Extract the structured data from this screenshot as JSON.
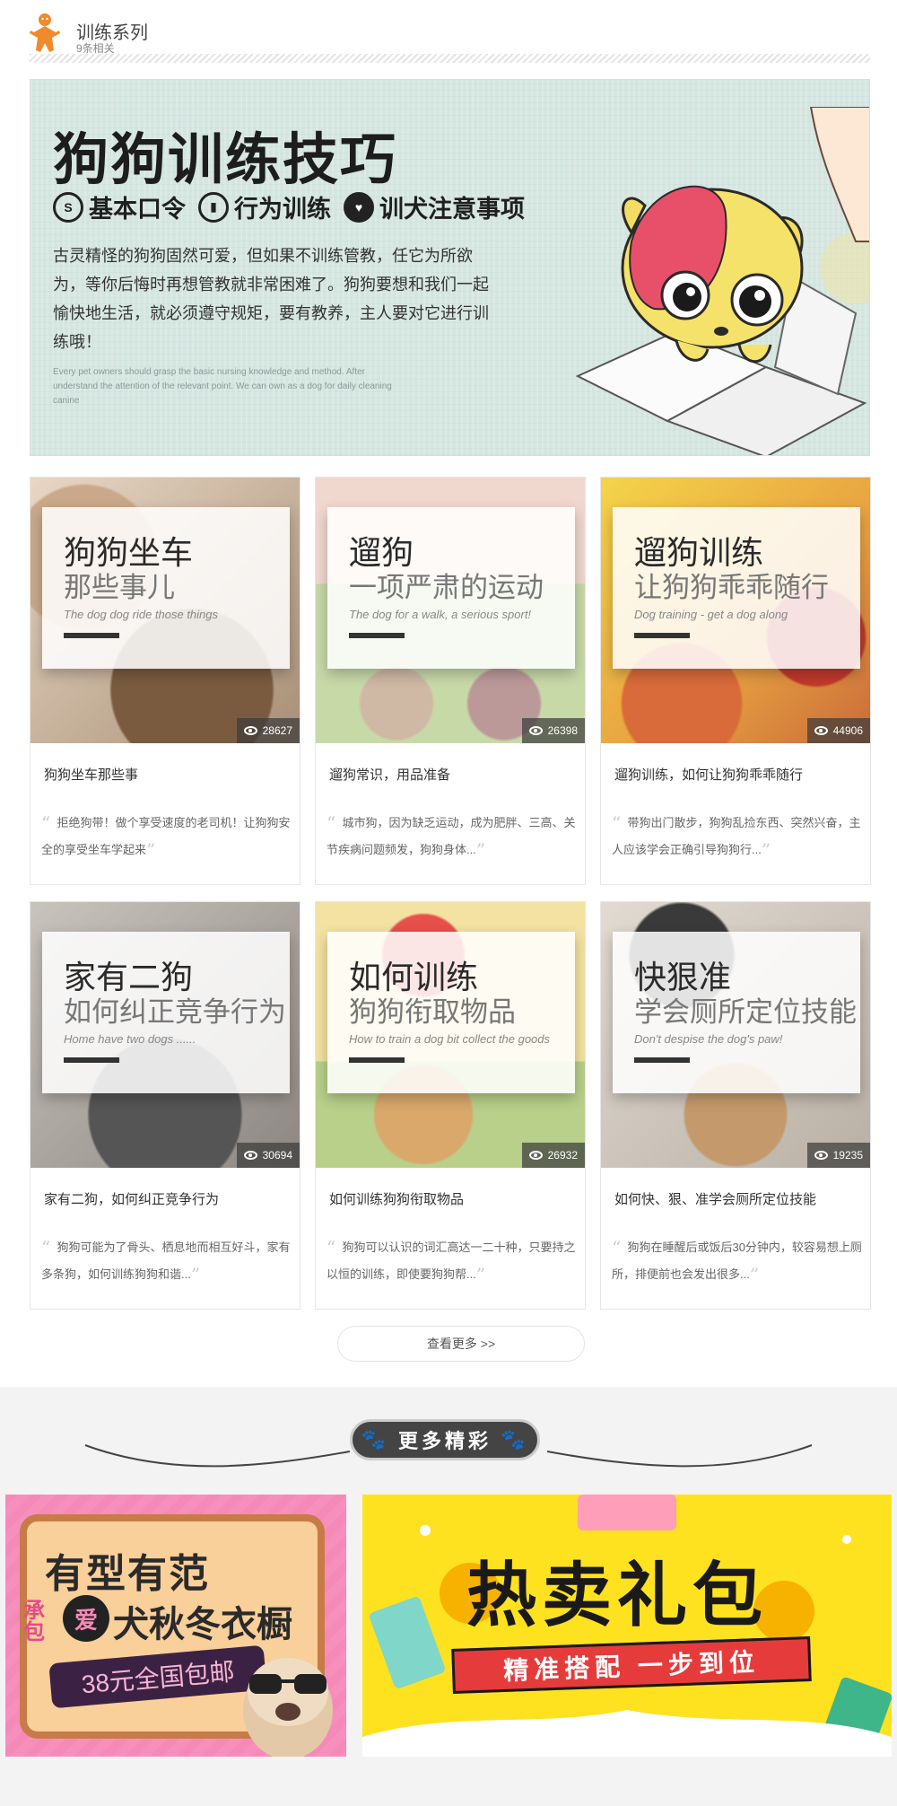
{
  "header": {
    "title": "训练系列",
    "subtitle": "9条相关"
  },
  "banner": {
    "title": "狗狗训练技巧",
    "tags": [
      "基本口令",
      "行为训练",
      "训犬注意事项"
    ],
    "description": "古灵精怪的狗狗固然可爱，但如果不训练管教，任它为所欲为，等你后悔时再想管教就非常困难了。狗狗要想和我们一起愉快地生活，就必须遵守规矩，要有教养，主人要对它进行训练哦！",
    "small_text": "Every pet owners should grasp the basic nursing knowledge and method. After understand the attention of the relevant point. We can own as a dog for daily cleaning canine"
  },
  "cards": [
    {
      "panel_title": "狗狗坐车",
      "panel_subtitle": "那些事儿",
      "panel_en": "The dog dog ride those things",
      "views": "28627",
      "title": "狗狗坐车那些事",
      "desc": "拒绝狗带！做个享受速度的老司机！让狗狗安全的享受坐车学起来"
    },
    {
      "panel_title": "遛狗",
      "panel_subtitle": "一项严肃的运动",
      "panel_en": "The dog for a walk, a serious sport!",
      "views": "26398",
      "title": "遛狗常识，用品准备",
      "desc": "城市狗，因为缺乏运动，成为肥胖、三高、关节疾病问题频发，狗狗身体..."
    },
    {
      "panel_title": "遛狗训练",
      "panel_subtitle": "让狗狗乖乖随行",
      "panel_en": "Dog training - get a dog along",
      "views": "44906",
      "title": "遛狗训练，如何让狗狗乖乖随行",
      "desc": "带狗出门散步，狗狗乱捡东西、突然兴奋，主人应该学会正确引导狗狗行..."
    },
    {
      "panel_title": "家有二狗",
      "panel_subtitle": "如何纠正竞争行为",
      "panel_en": "Home have two dogs ......",
      "views": "30694",
      "title": "家有二狗，如何纠正竞争行为",
      "desc": "狗狗可能为了骨头、栖息地而相互好斗，家有多条狗，如何训练狗狗和谐..."
    },
    {
      "panel_title": "如何训练",
      "panel_subtitle": "狗狗衔取物品",
      "panel_en": "How to train a dog bit collect the goods",
      "views": "26932",
      "title": "如何训练狗狗衔取物品",
      "desc": "狗狗可以认识的词汇高达一二十种，只要持之以恒的训练，即使要狗狗帮..."
    },
    {
      "panel_title": "快狠准",
      "panel_subtitle": "学会厕所定位技能",
      "panel_en": "Don't despise the dog's paw!",
      "views": "19235",
      "title": "如何快、狠、准学会厕所定位技能",
      "desc": "狗狗在睡醒后或饭后30分钟内，较容易想上厕所，排便前也会发出很多..."
    }
  ],
  "more_button": "查看更多 >>",
  "section_badge": "更多精彩",
  "promos": {
    "left": {
      "line1": "有型有范",
      "line2": "犬秋冬衣橱",
      "side_chars": "承包",
      "heart": "爱",
      "price": "38元全国包邮"
    },
    "right": {
      "title": "热卖礼包",
      "ribbon": "精准搭配 一步到位"
    }
  },
  "colors": {
    "accent": "#f08a2c",
    "badge": "#444444",
    "promo_pink": "#f58ab8",
    "promo_yellow": "#ffe21f"
  }
}
